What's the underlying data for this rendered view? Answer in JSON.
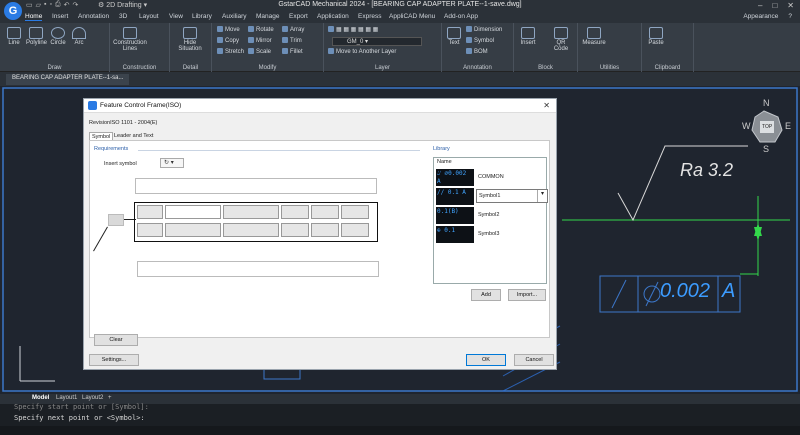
{
  "app": {
    "title": "GstarCAD Mechanical 2024 - [BEARING CAP ADAPTER PLATE--1-save.dwg]",
    "workspace": "2D Drafting",
    "window_controls": [
      "–",
      "□",
      "✕"
    ]
  },
  "menu_tabs": [
    "Home",
    "Insert",
    "Annotation",
    "3D",
    "Layout",
    "View",
    "Library",
    "Auxiliary",
    "Manage",
    "Export",
    "Application",
    "Express",
    "AppliCAD Menu",
    "Add-on App"
  ],
  "menu_right": [
    "Appearance",
    "?"
  ],
  "ribbon": {
    "draw": {
      "label": "Draw",
      "items": [
        "Line",
        "Polyline",
        "Circle",
        "Arc"
      ]
    },
    "construction": {
      "label": "Construction",
      "items": [
        "Construction Lines"
      ]
    },
    "detail": {
      "label": "Detail",
      "items": [
        "Hide Situation"
      ]
    },
    "modify": {
      "label": "Modify",
      "items": [
        "Move",
        "Rotate",
        "Array",
        "Copy",
        "Mirror",
        "Trim",
        "Stretch",
        "Scale",
        "Fillet"
      ]
    },
    "layer": {
      "label": "Layer",
      "combo": "GM_0",
      "move_label": "Move to Another Layer"
    },
    "annotation": {
      "label": "Annotation",
      "items": [
        "Text",
        "Dimension",
        "Symbol",
        "BOM"
      ]
    },
    "block": {
      "label": "Block",
      "items": [
        "Insert",
        "QR Code"
      ]
    },
    "utilities": {
      "label": "Utilities",
      "items": [
        "Measure"
      ]
    },
    "clipboard": {
      "label": "Clipboard",
      "items": [
        "Paste"
      ]
    }
  },
  "doc_tab": "BEARING CAP ADAPTER PLATE--1-sa...",
  "canvas": {
    "roughness": "Ra 3.2",
    "tolerance_value": "0.002",
    "datum": "A",
    "compass": {
      "n": "N",
      "s": "S",
      "e": "E",
      "w": "W",
      "top": "TOP"
    }
  },
  "layout_tabs": [
    "Model",
    "Layout1",
    "Layout2",
    "+"
  ],
  "command": {
    "history": "Specify start point or [Symbol]:",
    "prompt": "Specify next point or <Symbol>:"
  },
  "dialog": {
    "title": "Feature Control Frame(ISO)",
    "close": "✕",
    "revision": "RevisionISO 1101 - 2004(E)",
    "tabs": [
      "Symbol",
      "Leader and Text"
    ],
    "requirements_label": "Requirements",
    "insert_symbol_label": "Insert symbol",
    "library_label": "Library",
    "lib_header": "Name",
    "lib_items": [
      {
        "icon": "⌰ ⌀0.002 A",
        "name": "COMMON"
      },
      {
        "icon": "// 0.1 A",
        "name": "Symbol1"
      },
      {
        "icon": "0.1(B)",
        "name": "Symbol2"
      },
      {
        "icon": "⊕ 0.1",
        "name": "Symbol3"
      }
    ],
    "add_button": "Add",
    "import_button": "Import...",
    "clear_button": "Clear",
    "settings_button": "Settings...",
    "ok_button": "OK",
    "cancel_button": "Cancel"
  }
}
